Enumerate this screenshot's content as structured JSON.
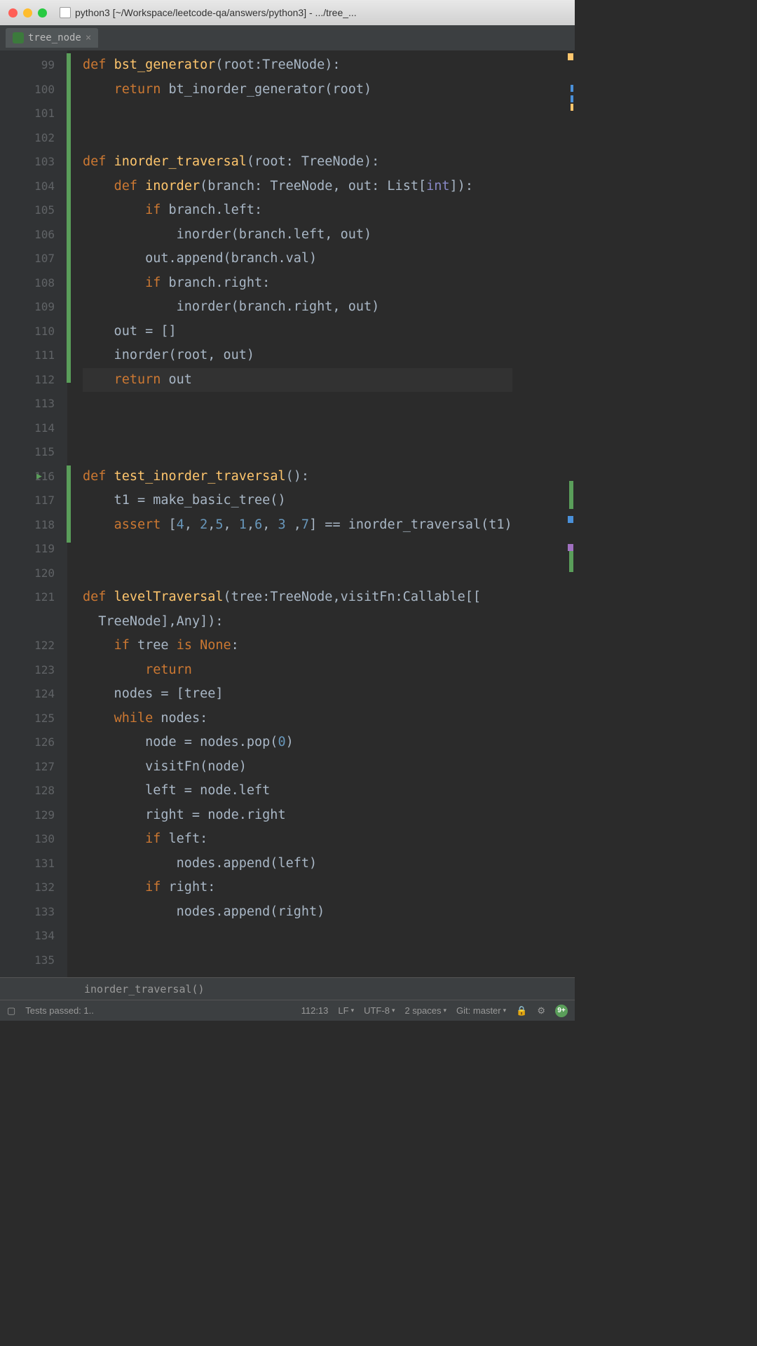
{
  "window": {
    "title": "python3 [~/Workspace/leetcode-qa/answers/python3] - .../tree_..."
  },
  "tab": {
    "label": "tree_node"
  },
  "gutter": {
    "start": 99,
    "end": 135
  },
  "code_lines": [
    {
      "n": 99,
      "tokens": [
        {
          "t": "kw",
          "v": "def "
        },
        {
          "t": "fn",
          "v": "bst_generator"
        },
        {
          "t": "op",
          "v": "(root:TreeNode):"
        }
      ]
    },
    {
      "n": 100,
      "tokens": [
        {
          "t": "op",
          "v": "    "
        },
        {
          "t": "kw",
          "v": "return "
        },
        {
          "t": "op",
          "v": "bt_inorder_generator(root)"
        }
      ]
    },
    {
      "n": 101,
      "tokens": []
    },
    {
      "n": 102,
      "tokens": []
    },
    {
      "n": 103,
      "tokens": [
        {
          "t": "kw",
          "v": "def "
        },
        {
          "t": "fn",
          "v": "inorder_traversal"
        },
        {
          "t": "op",
          "v": "(root: TreeNode):"
        }
      ]
    },
    {
      "n": 104,
      "tokens": [
        {
          "t": "op",
          "v": "    "
        },
        {
          "t": "kw",
          "v": "def "
        },
        {
          "t": "fn",
          "v": "inorder"
        },
        {
          "t": "op",
          "v": "(branch: TreeNode"
        },
        {
          "t": "op",
          "v": ", "
        },
        {
          "t": "op",
          "v": "out: List["
        },
        {
          "t": "builtin",
          "v": "int"
        },
        {
          "t": "op",
          "v": "]):"
        }
      ]
    },
    {
      "n": 105,
      "tokens": [
        {
          "t": "op",
          "v": "        "
        },
        {
          "t": "kw",
          "v": "if "
        },
        {
          "t": "op",
          "v": "branch.left:"
        }
      ]
    },
    {
      "n": 106,
      "tokens": [
        {
          "t": "op",
          "v": "            inorder(branch.left"
        },
        {
          "t": "op",
          "v": ", "
        },
        {
          "t": "op",
          "v": "out)"
        }
      ]
    },
    {
      "n": 107,
      "tokens": [
        {
          "t": "op",
          "v": "        out.append(branch.val)"
        }
      ]
    },
    {
      "n": 108,
      "tokens": [
        {
          "t": "op",
          "v": "        "
        },
        {
          "t": "kw",
          "v": "if "
        },
        {
          "t": "op",
          "v": "branch.right:"
        }
      ]
    },
    {
      "n": 109,
      "tokens": [
        {
          "t": "op",
          "v": "            inorder(branch.right"
        },
        {
          "t": "op",
          "v": ", "
        },
        {
          "t": "op",
          "v": "out)"
        }
      ]
    },
    {
      "n": 110,
      "tokens": [
        {
          "t": "op",
          "v": "    out = []"
        }
      ]
    },
    {
      "n": 111,
      "tokens": [
        {
          "t": "op",
          "v": "    inorder(root"
        },
        {
          "t": "op",
          "v": ", "
        },
        {
          "t": "op",
          "v": "out)"
        }
      ]
    },
    {
      "n": 112,
      "tokens": [
        {
          "t": "op",
          "v": "    "
        },
        {
          "t": "kw",
          "v": "return "
        },
        {
          "t": "op",
          "v": "out"
        }
      ]
    },
    {
      "n": 113,
      "tokens": []
    },
    {
      "n": 114,
      "tokens": []
    },
    {
      "n": 115,
      "tokens": []
    },
    {
      "n": 116,
      "tokens": [
        {
          "t": "kw",
          "v": "def "
        },
        {
          "t": "fn",
          "v": "test_inorder_traversal"
        },
        {
          "t": "op",
          "v": "():"
        }
      ]
    },
    {
      "n": 117,
      "tokens": [
        {
          "t": "op",
          "v": "    t1 = make_basic_tree()"
        }
      ]
    },
    {
      "n": 118,
      "tokens": [
        {
          "t": "op",
          "v": "    "
        },
        {
          "t": "kw",
          "v": "assert "
        },
        {
          "t": "op",
          "v": "["
        },
        {
          "t": "num",
          "v": "4"
        },
        {
          "t": "op",
          "v": ", "
        },
        {
          "t": "num",
          "v": "2"
        },
        {
          "t": "op",
          "v": ","
        },
        {
          "t": "num",
          "v": "5"
        },
        {
          "t": "op",
          "v": ", "
        },
        {
          "t": "num",
          "v": "1"
        },
        {
          "t": "op",
          "v": ","
        },
        {
          "t": "num",
          "v": "6"
        },
        {
          "t": "op",
          "v": ", "
        },
        {
          "t": "num",
          "v": "3"
        },
        {
          "t": "op",
          "v": " ,"
        },
        {
          "t": "num",
          "v": "7"
        },
        {
          "t": "op",
          "v": "] == inorder_traversal(t1)"
        }
      ]
    },
    {
      "n": 119,
      "tokens": []
    },
    {
      "n": 120,
      "tokens": []
    },
    {
      "n": 121,
      "tokens": [
        {
          "t": "kw",
          "v": "def "
        },
        {
          "t": "fn",
          "v": "levelTraversal"
        },
        {
          "t": "op",
          "v": "(tree:TreeNode"
        },
        {
          "t": "op",
          "v": ","
        },
        {
          "t": "op",
          "v": "visitFn:Callable[["
        }
      ]
    },
    {
      "n": "121b",
      "tokens": [
        {
          "t": "op",
          "v": "  TreeNode]"
        },
        {
          "t": "op",
          "v": ","
        },
        {
          "t": "op",
          "v": "Any]):"
        }
      ]
    },
    {
      "n": 122,
      "tokens": [
        {
          "t": "op",
          "v": "    "
        },
        {
          "t": "kw",
          "v": "if "
        },
        {
          "t": "op",
          "v": "tree "
        },
        {
          "t": "kw",
          "v": "is "
        },
        {
          "t": "kw",
          "v": "None"
        },
        {
          "t": "op",
          "v": ":"
        }
      ]
    },
    {
      "n": 123,
      "tokens": [
        {
          "t": "op",
          "v": "        "
        },
        {
          "t": "kw",
          "v": "return"
        }
      ]
    },
    {
      "n": 124,
      "tokens": [
        {
          "t": "op",
          "v": "    nodes = [tree]"
        }
      ]
    },
    {
      "n": 125,
      "tokens": [
        {
          "t": "op",
          "v": "    "
        },
        {
          "t": "kw",
          "v": "while "
        },
        {
          "t": "op",
          "v": "nodes:"
        }
      ]
    },
    {
      "n": 126,
      "tokens": [
        {
          "t": "op",
          "v": "        node = nodes.pop("
        },
        {
          "t": "num",
          "v": "0"
        },
        {
          "t": "op",
          "v": ")"
        }
      ]
    },
    {
      "n": 127,
      "tokens": [
        {
          "t": "op",
          "v": "        visitFn(node)"
        }
      ]
    },
    {
      "n": 128,
      "tokens": [
        {
          "t": "op",
          "v": "        left = node.left"
        }
      ]
    },
    {
      "n": 129,
      "tokens": [
        {
          "t": "op",
          "v": "        right = node.right"
        }
      ]
    },
    {
      "n": 130,
      "tokens": [
        {
          "t": "op",
          "v": "        "
        },
        {
          "t": "kw",
          "v": "if "
        },
        {
          "t": "op",
          "v": "left:"
        }
      ]
    },
    {
      "n": 131,
      "tokens": [
        {
          "t": "op",
          "v": "            nodes.append(left)"
        }
      ]
    },
    {
      "n": 132,
      "tokens": [
        {
          "t": "op",
          "v": "        "
        },
        {
          "t": "kw",
          "v": "if "
        },
        {
          "t": "op",
          "v": "right:"
        }
      ]
    },
    {
      "n": 133,
      "tokens": [
        {
          "t": "op",
          "v": "            nodes.append(right)"
        }
      ]
    },
    {
      "n": 134,
      "tokens": []
    },
    {
      "n": 135,
      "tokens": []
    }
  ],
  "breadcrumb": "inorder_traversal()",
  "statusbar": {
    "tests": "Tests passed: 1..",
    "cursor": "112:13",
    "line_ending": "LF",
    "encoding": "UTF-8",
    "indent": "2 spaces",
    "git": "Git: master",
    "notif": "9+"
  }
}
